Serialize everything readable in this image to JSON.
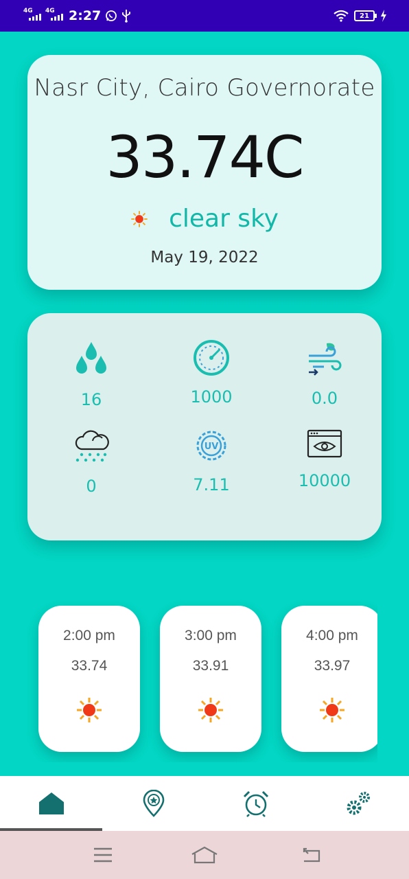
{
  "status_bar": {
    "network_1": "4G",
    "network_2": "4G",
    "time": "2:27",
    "battery": "21"
  },
  "weather": {
    "location": "Nasr City, Cairo Governorate",
    "temperature": "33.74C",
    "description": "clear sky",
    "date": "May 19, 2022"
  },
  "stats": [
    {
      "icon": "humidity-icon",
      "value": "16"
    },
    {
      "icon": "pressure-gauge-icon",
      "value": "1000"
    },
    {
      "icon": "wind-icon",
      "value": "0.0"
    },
    {
      "icon": "rain-cloud-icon",
      "value": "0"
    },
    {
      "icon": "uv-index-icon",
      "value": "7.11"
    },
    {
      "icon": "visibility-icon",
      "value": "10000"
    }
  ],
  "hourly": [
    {
      "time": "2:00 pm",
      "temp": "33.74"
    },
    {
      "time": "3:00 pm",
      "temp": "33.91"
    },
    {
      "time": "4:00 pm",
      "temp": "33.97"
    }
  ],
  "nav": [
    "home-icon",
    "location-pin-icon",
    "alarm-clock-icon",
    "settings-gears-icon"
  ],
  "colors": {
    "background": "#03d6c4",
    "status_bar": "#3100b4",
    "accent": "#12b7a8",
    "nav_icon": "#13706f"
  }
}
